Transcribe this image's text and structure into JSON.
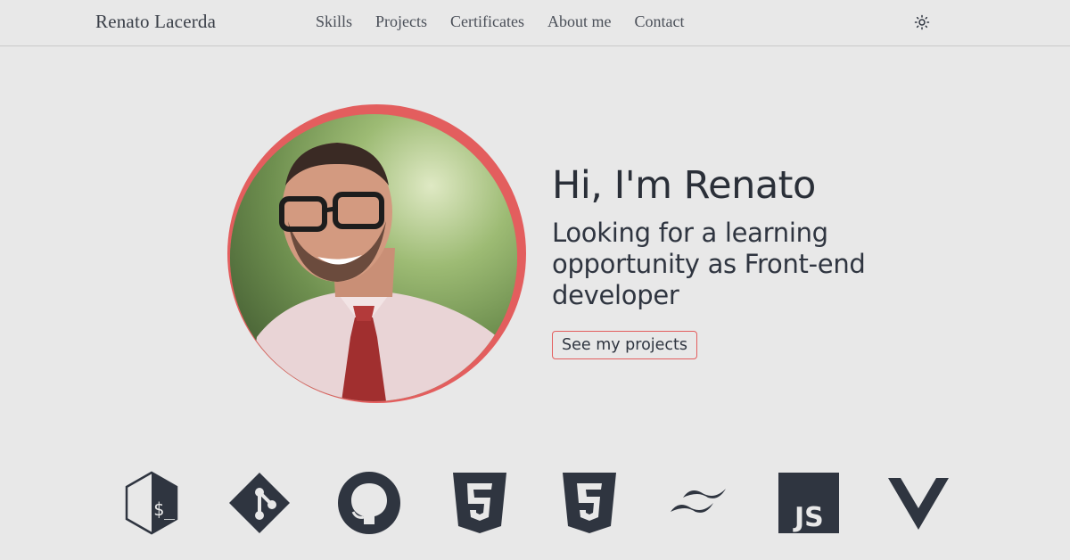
{
  "header": {
    "brand": "Renato Lacerda",
    "nav": [
      "Skills",
      "Projects",
      "Certificates",
      "About me",
      "Contact"
    ],
    "theme_icon": "sun-icon"
  },
  "hero": {
    "title": "Hi, I'm Renato",
    "subtitle": "Looking for a learning opportunity as Front-end developer",
    "cta_label": "See my projects",
    "accent_color": "#e35e5e"
  },
  "tech_icons": [
    "bash-icon",
    "git-icon",
    "github-icon",
    "html5-icon",
    "css3-icon",
    "tailwind-icon",
    "javascript-icon",
    "vue-icon"
  ]
}
